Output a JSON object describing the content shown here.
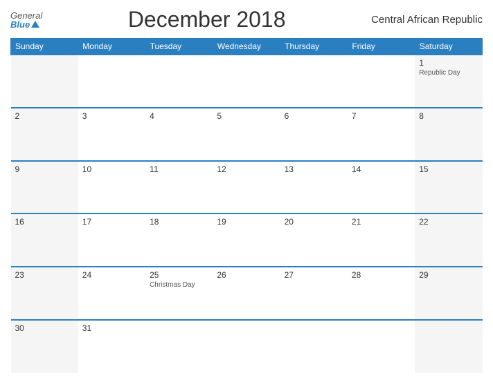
{
  "header": {
    "logo_general": "General",
    "logo_blue": "Blue",
    "title": "December 2018",
    "country": "Central African Republic"
  },
  "weekdays": [
    "Sunday",
    "Monday",
    "Tuesday",
    "Wednesday",
    "Thursday",
    "Friday",
    "Saturday"
  ],
  "weeks": [
    [
      {
        "day": "",
        "holiday": ""
      },
      {
        "day": "",
        "holiday": ""
      },
      {
        "day": "",
        "holiday": ""
      },
      {
        "day": "",
        "holiday": ""
      },
      {
        "day": "",
        "holiday": ""
      },
      {
        "day": "",
        "holiday": ""
      },
      {
        "day": "1",
        "holiday": "Republic Day"
      }
    ],
    [
      {
        "day": "2",
        "holiday": ""
      },
      {
        "day": "3",
        "holiday": ""
      },
      {
        "day": "4",
        "holiday": ""
      },
      {
        "day": "5",
        "holiday": ""
      },
      {
        "day": "6",
        "holiday": ""
      },
      {
        "day": "7",
        "holiday": ""
      },
      {
        "day": "8",
        "holiday": ""
      }
    ],
    [
      {
        "day": "9",
        "holiday": ""
      },
      {
        "day": "10",
        "holiday": ""
      },
      {
        "day": "11",
        "holiday": ""
      },
      {
        "day": "12",
        "holiday": ""
      },
      {
        "day": "13",
        "holiday": ""
      },
      {
        "day": "14",
        "holiday": ""
      },
      {
        "day": "15",
        "holiday": ""
      }
    ],
    [
      {
        "day": "16",
        "holiday": ""
      },
      {
        "day": "17",
        "holiday": ""
      },
      {
        "day": "18",
        "holiday": ""
      },
      {
        "day": "19",
        "holiday": ""
      },
      {
        "day": "20",
        "holiday": ""
      },
      {
        "day": "21",
        "holiday": ""
      },
      {
        "day": "22",
        "holiday": ""
      }
    ],
    [
      {
        "day": "23",
        "holiday": ""
      },
      {
        "day": "24",
        "holiday": ""
      },
      {
        "day": "25",
        "holiday": "Christmas Day"
      },
      {
        "day": "26",
        "holiday": ""
      },
      {
        "day": "27",
        "holiday": ""
      },
      {
        "day": "28",
        "holiday": ""
      },
      {
        "day": "29",
        "holiday": ""
      }
    ],
    [
      {
        "day": "30",
        "holiday": ""
      },
      {
        "day": "31",
        "holiday": ""
      },
      {
        "day": "",
        "holiday": ""
      },
      {
        "day": "",
        "holiday": ""
      },
      {
        "day": "",
        "holiday": ""
      },
      {
        "day": "",
        "holiday": ""
      },
      {
        "day": "",
        "holiday": ""
      }
    ]
  ]
}
